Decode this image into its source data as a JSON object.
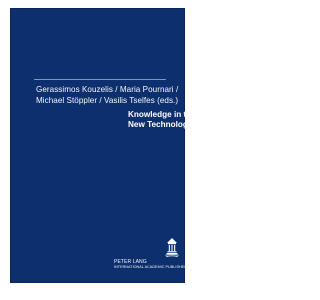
{
  "cover": {
    "authors": [
      "Gerassimos Kouzelis / Maria Pournari /",
      "Michael Stöppler / Vasilis Tselfes (eds.)"
    ],
    "title_lines": [
      "Knowledge in the",
      "New Technologies"
    ],
    "publisher_name": "PETER LANG",
    "publisher_subtitle": "INTERNATIONAL ACADEMIC PUBLISHERS",
    "logo_icon": "temple-icon",
    "colors": {
      "cover_background": "#0d2f6d",
      "text": "#ffffff",
      "rule": "#7f94bd"
    }
  }
}
